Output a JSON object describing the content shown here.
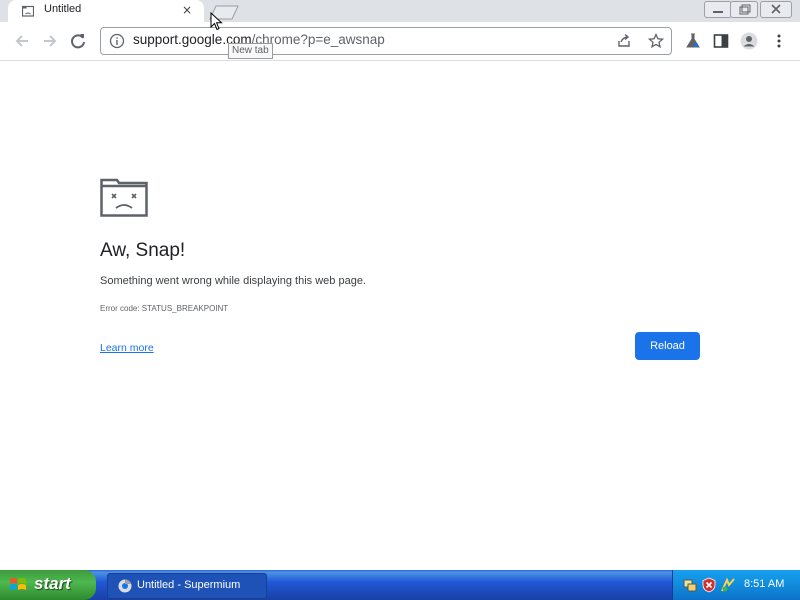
{
  "tab": {
    "title": "Untitled",
    "favicon": "sad-folder-icon",
    "close": "×"
  },
  "tooltip": {
    "text": "New tab"
  },
  "omnibox": {
    "host": "support.google.com",
    "path": "/chrome?p=e_awsnap"
  },
  "error": {
    "title": "Aw, Snap!",
    "message": "Something went wrong while displaying this web page.",
    "code": "Error code: STATUS_BREAKPOINT",
    "learn_more": "Learn more",
    "reload": "Reload"
  },
  "taskbar": {
    "start": "start",
    "task": "Untitled - Supermium",
    "clock": "8:51 AM"
  },
  "colors": {
    "accent": "#1a73e8",
    "taskbar": "#245edb",
    "start": "#3c9a3c"
  }
}
